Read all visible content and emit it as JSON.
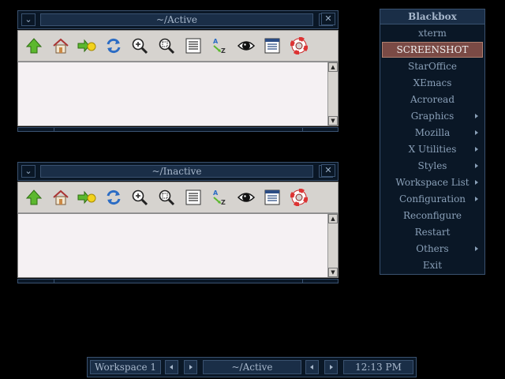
{
  "windows": [
    {
      "title": "~/Active",
      "toolbar_icons": [
        "up-arrow-icon",
        "home-icon",
        "go-icon",
        "reload-icon",
        "zoom-in-icon",
        "zoom-out-icon",
        "list-view-icon",
        "sort-az-icon",
        "eye-icon",
        "detail-view-icon",
        "help-lifebuoy-icon"
      ],
      "controls": {
        "shade": "⌄",
        "maximize": "□",
        "close": "✕"
      }
    },
    {
      "title": "~/Inactive",
      "toolbar_icons": [
        "up-arrow-icon",
        "home-icon",
        "go-icon",
        "reload-icon",
        "zoom-in-icon",
        "zoom-out-icon",
        "list-view-icon",
        "sort-az-icon",
        "eye-icon",
        "detail-view-icon",
        "help-lifebuoy-icon"
      ],
      "controls": {
        "shade": "⌄",
        "maximize": "□",
        "close": "✕"
      }
    }
  ],
  "menu": {
    "title": "Blackbox",
    "items": [
      {
        "label": "xterm",
        "submenu": false
      },
      {
        "label": "SCREENSHOT",
        "submenu": false,
        "selected": true
      },
      {
        "label": "StarOffice",
        "submenu": false
      },
      {
        "label": "XEmacs",
        "submenu": false
      },
      {
        "label": "Acroread",
        "submenu": false
      },
      {
        "label": "Graphics",
        "submenu": true
      },
      {
        "label": "Mozilla",
        "submenu": true
      },
      {
        "label": "X Utilities",
        "submenu": true
      },
      {
        "label": "Styles",
        "submenu": true
      },
      {
        "label": "Workspace List",
        "submenu": true
      },
      {
        "label": "Configuration",
        "submenu": true
      },
      {
        "label": "Reconfigure",
        "submenu": false
      },
      {
        "label": "Restart",
        "submenu": false
      },
      {
        "label": "Others",
        "submenu": true
      },
      {
        "label": "Exit",
        "submenu": false
      }
    ]
  },
  "taskbar": {
    "workspace": "Workspace 1",
    "active_window": "~/Active",
    "clock": "12:13 PM"
  },
  "colors": {
    "frame": "#0a1726",
    "border": "#3a5270",
    "label_bg": "#1a2e47",
    "selected_item": "#7a4a45",
    "toolbar": "#d6d3cf",
    "content": "#f5f1f3"
  }
}
